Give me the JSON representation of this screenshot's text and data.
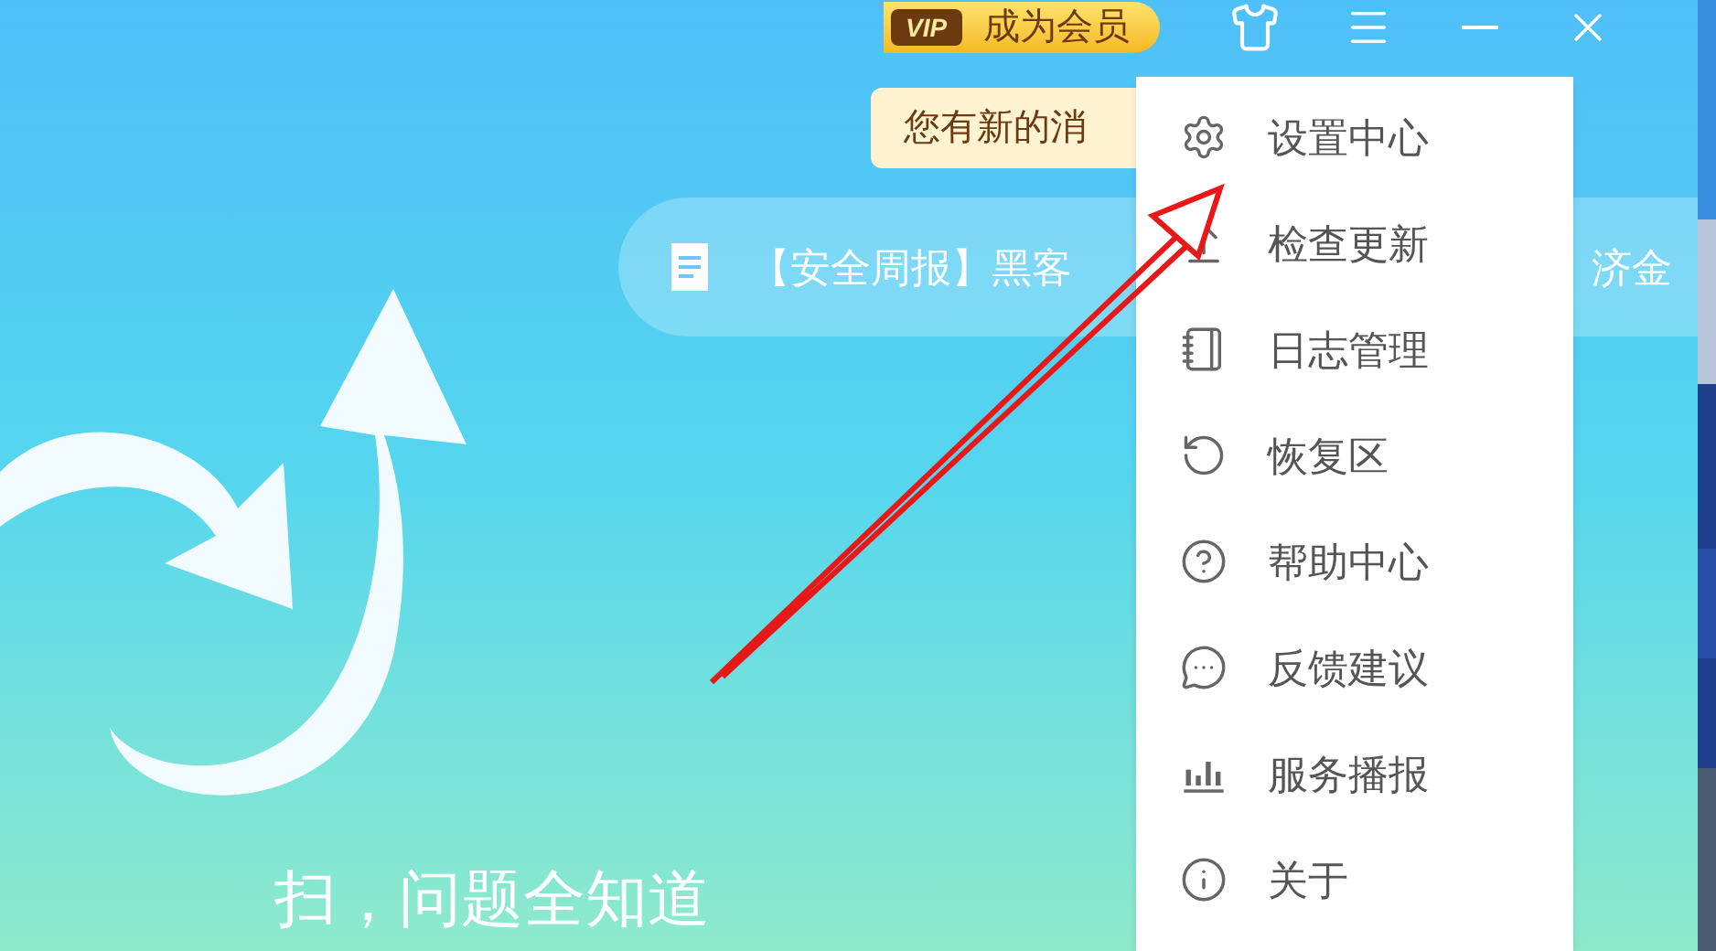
{
  "toolbar": {
    "vip_badge": "VIP",
    "member_button": "成为会员"
  },
  "notice": {
    "text": "您有新的消"
  },
  "news_ticker": {
    "headline": "【安全周报】黑客",
    "tail": "济金"
  },
  "menu": {
    "items": [
      {
        "kind": "settings",
        "label": "设置中心"
      },
      {
        "kind": "update",
        "label": "检查更新"
      },
      {
        "kind": "log",
        "label": "日志管理"
      },
      {
        "kind": "restore",
        "label": "恢复区"
      },
      {
        "kind": "help",
        "label": "帮助中心"
      },
      {
        "kind": "feedback",
        "label": "反馈建议"
      },
      {
        "kind": "stats",
        "label": "服务播报"
      },
      {
        "kind": "about",
        "label": "关于"
      }
    ]
  },
  "slogan": "扫，问题全知道"
}
